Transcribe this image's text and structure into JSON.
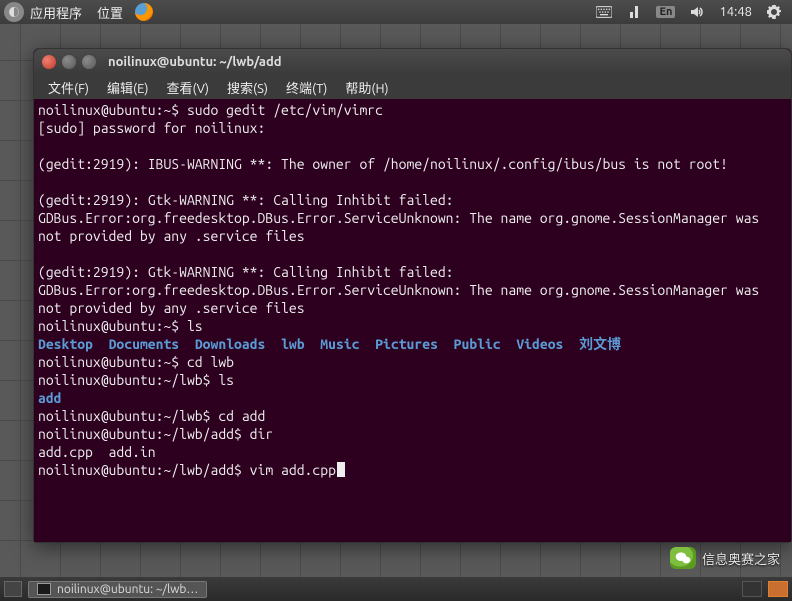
{
  "menubar": {
    "apps": "应用程序",
    "places": "位置",
    "input_badge": "En",
    "clock": "14:48"
  },
  "window": {
    "title": "noilinux@ubuntu: ~/lwb/add",
    "menu": {
      "file": "文件(F)",
      "edit": "编辑(E)",
      "view": "查看(V)",
      "search": "搜索(S)",
      "terminal": "终端(T)",
      "help": "帮助(H)"
    }
  },
  "terminal": {
    "l01": "noilinux@ubuntu:~$ sudo gedit /etc/vim/vimrc",
    "l02": "[sudo] password for noilinux:",
    "l03": "",
    "l04": "(gedit:2919): IBUS-WARNING **: The owner of /home/noilinux/.config/ibus/bus is not root!",
    "l05": "",
    "l06": "(gedit:2919): Gtk-WARNING **: Calling Inhibit failed: GDBus.Error:org.freedesktop.DBus.Error.ServiceUnknown: The name org.gnome.SessionManager was not provided by any .service files",
    "l07": "",
    "l08": "(gedit:2919): Gtk-WARNING **: Calling Inhibit failed: GDBus.Error:org.freedesktop.DBus.Error.ServiceUnknown: The name org.gnome.SessionManager was not provided by any .service files",
    "l09": "noilinux@ubuntu:~$ ls",
    "dirs": {
      "d1": "Desktop",
      "d2": "Documents",
      "d3": "Downloads",
      "d4": "lwb",
      "d5": "Music",
      "d6": "Pictures",
      "d7": "Public",
      "d8": "Videos",
      "d9": "刘文博"
    },
    "l11": "noilinux@ubuntu:~$ cd lwb",
    "l12": "noilinux@ubuntu:~/lwb$ ls",
    "l13": "add",
    "l14": "noilinux@ubuntu:~/lwb$ cd add",
    "l15": "noilinux@ubuntu:~/lwb/add$ dir",
    "l16": "add.cpp  add.in",
    "l17": "noilinux@ubuntu:~/lwb/add$ vim add.cpp"
  },
  "taskbar": {
    "task1": "noilinux@ubuntu: ~/lwb…"
  },
  "watermark": {
    "text": "信息奥赛之家"
  }
}
